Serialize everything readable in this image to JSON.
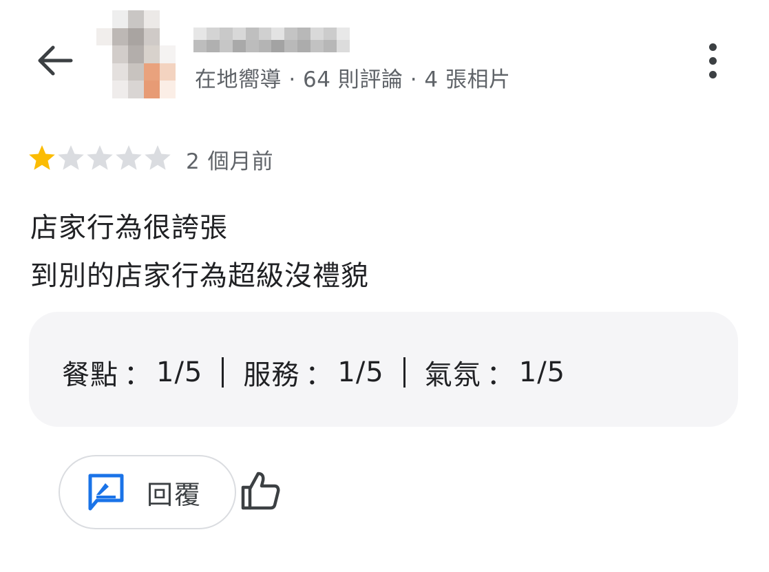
{
  "header": {
    "back_icon": "arrow-back-icon",
    "meta": "在地嚮導 · 64 則評論 · 4 張相片",
    "more_icon": "more-vert-icon"
  },
  "review": {
    "rating": 1,
    "rating_max": 5,
    "star_filled_color": "#fbbc04",
    "star_empty_color": "#dadce0",
    "time": "2 個月前",
    "lines": [
      "店家行為很誇張",
      "到別的店家行為超級沒禮貌"
    ]
  },
  "attributes": [
    {
      "label": "餐點",
      "value": "1/5"
    },
    {
      "label": "服務",
      "value": "1/5"
    },
    {
      "label": "氣氛",
      "value": "1/5"
    }
  ],
  "actions": {
    "reply_label": "回覆",
    "reply_icon": "reply-message-icon",
    "like_icon": "thumb-up-icon",
    "accent_color": "#1a73e8"
  }
}
